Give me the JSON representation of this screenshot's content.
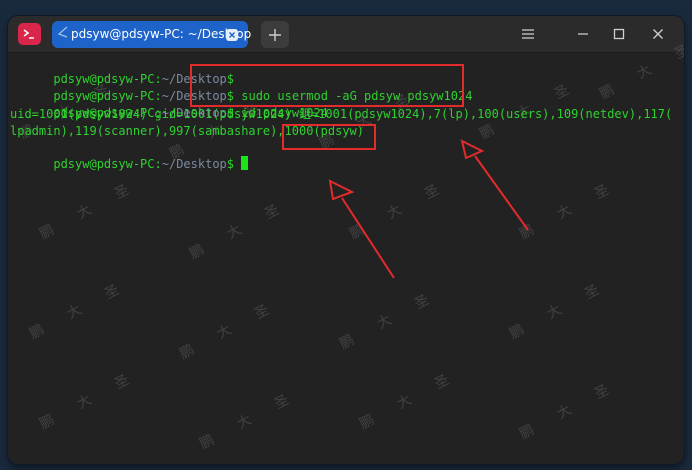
{
  "window": {
    "tab_title": "pdsyw@pdsyw-PC: ~/Desktop",
    "icons": {
      "app": "terminal-app-icon",
      "tab_back": "back-arrow-icon",
      "tab_close": "close-icon",
      "new_tab": "plus-icon",
      "menu": "menu-icon",
      "minimize": "minimize-icon",
      "maximize": "maximize-icon",
      "close": "close-icon"
    }
  },
  "terminal": {
    "prompt_user": "pdsyw@pdsyw-PC",
    "prompt_sep": ":",
    "prompt_path": "~/Desktop",
    "prompt_symbol": "$",
    "lines": [
      {
        "cmd": ""
      },
      {
        "cmd": " sudo usermod -aG pdsyw pdsyw1024"
      },
      {
        "cmd": " id pdsyw1024"
      }
    ],
    "output": [
      "uid=1001(pdsyw1024) gid=1001(pdsyw1024) 组=1001(pdsyw1024),7(lp),100(users),109(netdev),117(",
      "lpadmin),119(scanner),997(sambashare),1000(pdsyw)"
    ],
    "last_prompt_cmd": " "
  },
  "watermark": "鹏 大 圣",
  "colors": {
    "terminal_bg": "#222222",
    "prompt_green": "#2fd12f",
    "path_grey": "#7a8aa0",
    "highlight_red": "#e22b2b",
    "tab_blue": "#1e63c9",
    "app_icon_red": "#d9264a"
  }
}
